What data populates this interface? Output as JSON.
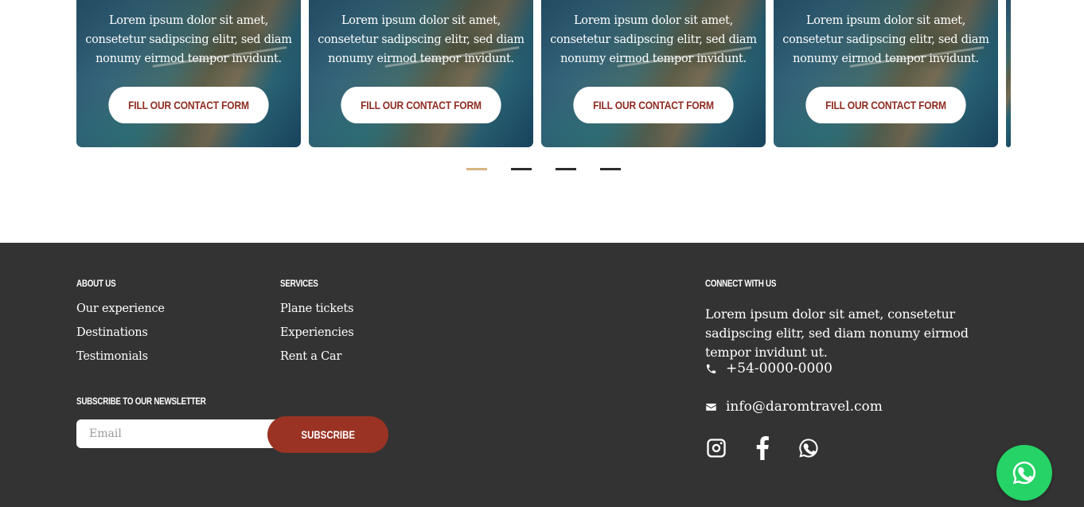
{
  "carousel": {
    "cards": [
      {
        "text": "Lorem ipsum dolor sit amet, consetetur sadipscing elitr, sed diam nonumy eirmod tempor invidunt.",
        "button": "Fill our contact form"
      },
      {
        "text": "Lorem ipsum dolor sit amet, consetetur sadipscing elitr, sed diam nonumy eirmod tempor invidunt.",
        "button": "Fill our contact form"
      },
      {
        "text": "Lorem ipsum dolor sit amet, consetetur sadipscing elitr, sed diam nonumy eirmod tempor invidunt.",
        "button": "Fill our contact form"
      },
      {
        "text": "Lorem ipsum dolor sit amet, consetetur sadipscing elitr, sed diam nonumy eirmod tempor invidunt.",
        "button": "Fill our contact form"
      }
    ],
    "pagination": {
      "count": 4,
      "active_index": 0,
      "active_color": "#d6b480",
      "inactive_color": "#2c2c2c"
    }
  },
  "footer": {
    "background": "#333333",
    "about": {
      "heading": "About us",
      "links": [
        "Our experience",
        "Destinations",
        "Testimonials"
      ]
    },
    "services": {
      "heading": "Services",
      "links": [
        "Plane tickets",
        "Experiencies",
        "Rent a Car"
      ]
    },
    "newsletter": {
      "heading": "Subscribe to our newsletter",
      "email_placeholder": "Email",
      "button": "Subscribe",
      "button_color": "#9a3324"
    },
    "connect": {
      "heading": "Connect with us",
      "text": "Lorem ipsum dolor sit amet, consetetur sadipscing elitr, sed diam nonumy eirmod tempor invidunt ut.",
      "phone": "+54-0000-0000",
      "email": "info@daromtravel.com",
      "socials": [
        "instagram-icon",
        "facebook-icon",
        "whatsapp-icon"
      ]
    }
  },
  "whatsapp_float": {
    "icon": "whatsapp-icon",
    "color": "#25d366"
  }
}
